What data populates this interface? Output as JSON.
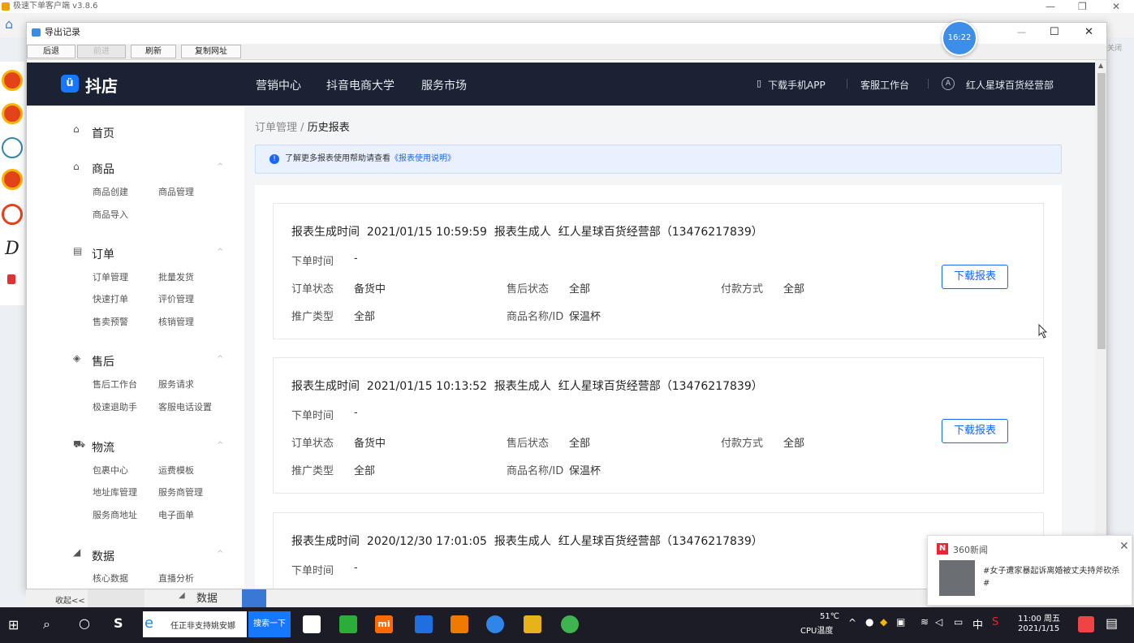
{
  "outer": {
    "title": "极速下单客户端 v3.8.6",
    "minimize": "—",
    "restore": "❐",
    "close": "✕",
    "right_hint": "关闭"
  },
  "window": {
    "title": "导出记录",
    "min": "—",
    "max": "☐",
    "close": "✕",
    "toolbar": {
      "back": "后退",
      "forward": "前进",
      "refresh": "刷新",
      "copy_url": "复制网址"
    }
  },
  "header": {
    "logo": "抖店",
    "logo_mark": "ü",
    "nav": [
      "营销中心",
      "抖音电商大学",
      "服务市场"
    ],
    "download_app": "下载手机APP",
    "service_desk": "客服工作台",
    "shop_name": "红人星球百货经营部",
    "time_bubble": "16:22"
  },
  "sidebar": {
    "home": "首页",
    "sections": [
      {
        "title": "商品",
        "icon": "bag-icon",
        "items": [
          "商品创建",
          "商品管理",
          "商品导入"
        ]
      },
      {
        "title": "订单",
        "icon": "clipboard-icon",
        "items": [
          "订单管理",
          "批量发货",
          "快速打单",
          "评价管理",
          "售卖预警",
          "核销管理"
        ]
      },
      {
        "title": "售后",
        "icon": "cube-icon",
        "items": [
          "售后工作台",
          "服务请求",
          "极速退助手",
          "客服电话设置"
        ]
      },
      {
        "title": "物流",
        "icon": "truck-icon",
        "items": [
          "包裹中心",
          "运费模板",
          "地址库管理",
          "服务商管理",
          "服务商地址",
          "电子面单"
        ]
      },
      {
        "title": "数据",
        "icon": "chart-icon",
        "items": [
          "核心数据",
          "直播分析"
        ]
      }
    ]
  },
  "breadcrumb": {
    "parent": "订单管理",
    "sep": "/",
    "current": "历史报表"
  },
  "tip": {
    "text": "了解更多报表使用帮助请查看",
    "link": "《报表使用说明》"
  },
  "labels": {
    "created_at": "报表生成时间",
    "creator": "报表生成人",
    "order_time": "下单时间",
    "order_status": "订单状态",
    "after_sale": "售后状态",
    "payment": "付款方式",
    "promo_type": "推广类型",
    "product": "商品名称/ID",
    "download": "下载报表"
  },
  "reports": [
    {
      "time": "2021/01/15 10:59:59",
      "creator": "红人星球百货经营部（13476217839）",
      "order_time": "-",
      "order_status": "备货中",
      "after_sale": "全部",
      "payment": "全部",
      "promo_type": "全部",
      "product": "保温杯"
    },
    {
      "time": "2021/01/15 10:13:52",
      "creator": "红人星球百货经营部（13476217839）",
      "order_time": "-",
      "order_status": "备货中",
      "after_sale": "全部",
      "payment": "全部",
      "promo_type": "全部",
      "product": "保温杯"
    },
    {
      "time": "2020/12/30 17:01:05",
      "creator": "红人星球百货经营部（13476217839）",
      "order_time": "-"
    }
  ],
  "bottom": {
    "collapse": "收起<<",
    "data_label": "数据"
  },
  "news": {
    "source": "360新闻",
    "text": "#女子遭家暴起诉离婚被丈夫持斧砍杀#",
    "close": "✕"
  },
  "taskbar": {
    "browser_text": "任正非支持姚安娜",
    "search_btn": "搜索一下",
    "cpu_temp": "51℃",
    "cpu_label": "CPU温度",
    "ime": "中",
    "time": "11:00 周五",
    "date": "2021/1/15"
  }
}
